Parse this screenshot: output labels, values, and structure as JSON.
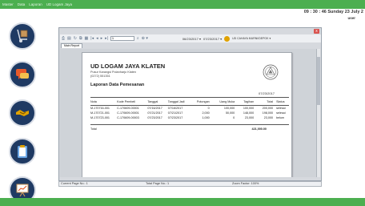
{
  "menu": [
    "Master",
    "Data",
    "Laporan",
    "UD Logam Jaya"
  ],
  "clock": "09 : 30 : 46  Sunday 23 July 2",
  "user": "user",
  "sidebar": [
    {
      "icon": "dolly-icon"
    },
    {
      "icon": "chat-icon"
    },
    {
      "icon": "handshake-icon"
    },
    {
      "icon": "clipboard-icon"
    },
    {
      "icon": "chart-presentation-icon"
    }
  ],
  "viewer": {
    "close_label": "x",
    "page_input": "1",
    "zoom_label": "⊕ ▾",
    "date_from": "06/23/2017 ▾",
    "date_to": "07/23/2017 ▾",
    "company_filter": "UD CAHAYA MURNI/DEPOK ▾",
    "tab": "Main Report"
  },
  "report": {
    "company": "UD LOGAM JAYA KLATEN",
    "address_1": "Pusur Karangsi Polanharjo Klaten",
    "address_2": "(0272) 551351",
    "title": "Laporan Data Pemesanan",
    "date": "07/23/2017",
    "columns": [
      "Nota",
      "Kode Pembeli",
      "Tanggal",
      "Tanggal Jadi",
      "Potongan",
      "Uang Muka",
      "Tagihan",
      "Total",
      "Status"
    ],
    "rows": [
      [
        "M-170716-001",
        "C-170609-00001",
        "07/16/2017",
        "07/16/2017",
        "0",
        "100,000",
        "100,000",
        "200,000",
        "selesai"
      ],
      [
        "M-170721-001",
        "C-170609-00001",
        "07/21/2017",
        "07/21/2017",
        "2,000",
        "50,000",
        "148,000",
        "198,000",
        "selesai"
      ],
      [
        "M-170723-001",
        "C-170609-00003",
        "07/23/2017",
        "07/23/2017",
        "1,000",
        "0",
        "23,000",
        "23,000",
        "belum"
      ]
    ],
    "total_label": "Total",
    "total_value": "421,000.00"
  },
  "status": {
    "current_page": "Current Page No.: 1",
    "total_page": "Total Page No.: 1",
    "zoom": "Zoom Factor: 100%"
  }
}
